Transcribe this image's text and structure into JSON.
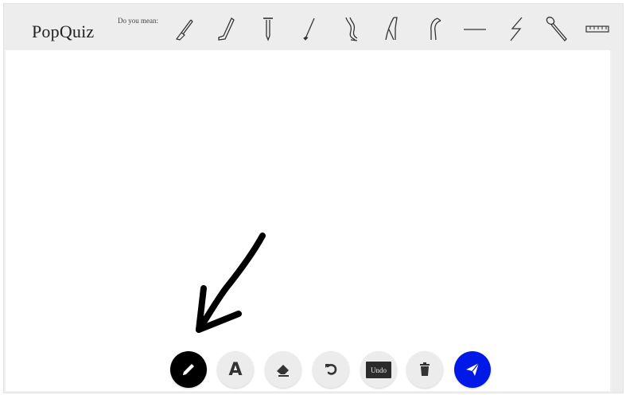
{
  "header": {
    "app_title": "PopQuiz",
    "suggest_label": "Do you mean:",
    "suggestions": [
      {
        "icon": "brush-icon"
      },
      {
        "icon": "hockey-stick-icon"
      },
      {
        "icon": "nail-icon"
      },
      {
        "icon": "golf-club-icon"
      },
      {
        "icon": "leg-icon"
      },
      {
        "icon": "high-heel-icon"
      },
      {
        "icon": "boot-icon"
      },
      {
        "icon": "line-icon"
      },
      {
        "icon": "lightning-icon"
      },
      {
        "icon": "spoon-icon"
      },
      {
        "icon": "ruler-icon"
      }
    ]
  },
  "toolbar": {
    "pencil": {
      "icon": "pencil-icon",
      "active": true
    },
    "text": {
      "icon": "text-icon",
      "label": "A"
    },
    "eraser": {
      "icon": "eraser-icon"
    },
    "undo": {
      "icon": "undo-icon"
    },
    "undo_chip_label": "Undo",
    "delete": {
      "icon": "trash-icon"
    },
    "send": {
      "icon": "send-icon"
    }
  },
  "colors": {
    "header_bg": "#ededee",
    "canvas_bg": "#ffffff",
    "active_tool": "#000000",
    "send_button": "#0019e6",
    "tool_button": "#ececec"
  },
  "annotation": {
    "icon": "arrow-annotation-icon"
  }
}
